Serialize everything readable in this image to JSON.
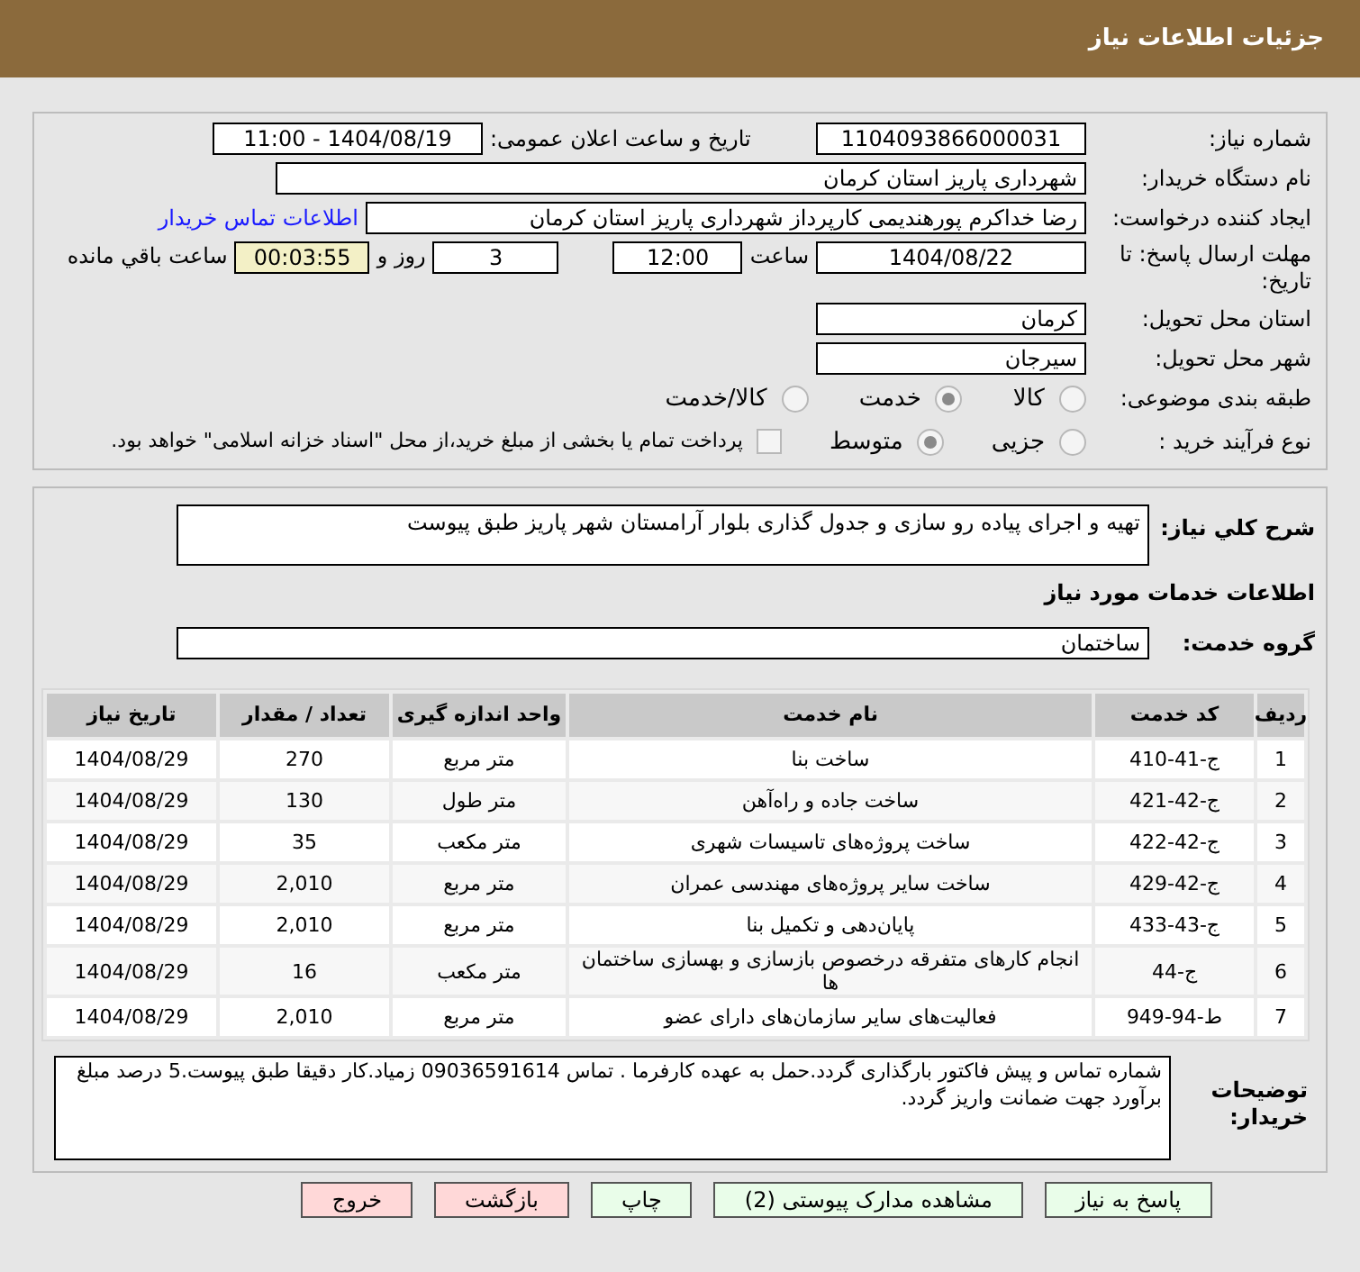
{
  "header": {
    "title": "جزئیات اطلاعات نیاز"
  },
  "need_number": {
    "label": "شماره نیاز:",
    "value": "1104093866000031"
  },
  "announce": {
    "label": "تاریخ و ساعت اعلان عمومی:",
    "value": "1404/08/19 - 11:00"
  },
  "buyer": {
    "label": "نام دستگاه خریدار:",
    "value": "شهرداری پاریز استان کرمان"
  },
  "creator": {
    "label": "ایجاد کننده درخواست:",
    "value": "رضا خداکرم پورهندیمی کارپرداز شهرداری پاریز استان کرمان",
    "link": "اطلاعات تماس خریدار"
  },
  "deadline": {
    "label": "مهلت ارسال پاسخ: تا تاریخ:",
    "date": "1404/08/22",
    "time_label": "ساعت",
    "time": "12:00",
    "days": "3",
    "days_label": "روز و",
    "remaining": "00:03:55",
    "remaining_label": "ساعت باقي مانده"
  },
  "province": {
    "label": "استان محل تحویل:",
    "value": "کرمان"
  },
  "city": {
    "label": "شهر محل تحویل:",
    "value": "سیرجان"
  },
  "category": {
    "label": "طبقه بندی موضوعی:",
    "options": [
      {
        "label": "کالا",
        "selected": false
      },
      {
        "label": "خدمت",
        "selected": true
      },
      {
        "label": "کالا/خدمت",
        "selected": false
      }
    ]
  },
  "purchase_type": {
    "label": "نوع فرآیند خرید :",
    "options": [
      {
        "label": "جزیی",
        "selected": false
      },
      {
        "label": "متوسط",
        "selected": true
      }
    ],
    "payment": {
      "checked": false,
      "text": "پرداخت تمام یا بخشی از مبلغ خرید،از محل \"اسناد خزانه اسلامی\" خواهد بود."
    }
  },
  "summary": {
    "label": "شرح کلي نیاز:",
    "value": "تهیه و اجرای پیاده رو سازی و جدول گذاری بلوار آرامستان شهر پاریز طبق پیوست"
  },
  "services_title": "اطلاعات خدمات مورد نیاز",
  "service_group": {
    "label": "گروه خدمت:",
    "value": "ساختمان"
  },
  "table": {
    "columns": [
      "ردیف",
      "کد خدمت",
      "نام خدمت",
      "واحد اندازه گیری",
      "تعداد / مقدار",
      "تاریخ نیاز"
    ],
    "rows": [
      [
        "1",
        "ج-41-410",
        "ساخت بنا",
        "متر مربع",
        "270",
        "1404/08/29"
      ],
      [
        "2",
        "ج-42-421",
        "ساخت جاده و راه‌آهن",
        "متر طول",
        "130",
        "1404/08/29"
      ],
      [
        "3",
        "ج-42-422",
        "ساخت پروژه‌های تاسیسات شهری",
        "متر مکعب",
        "35",
        "1404/08/29"
      ],
      [
        "4",
        "ج-42-429",
        "ساخت سایر پروژه‌های مهندسی عمران",
        "متر مربع",
        "2,010",
        "1404/08/29"
      ],
      [
        "5",
        "ج-43-433",
        "پایان‌دهی و تکمیل بنا",
        "متر مربع",
        "2,010",
        "1404/08/29"
      ],
      [
        "6",
        "ج-44",
        "انجام کارهای متفرقه درخصوص بازسازی و بهسازی ساختمان ها",
        "متر مکعب",
        "16",
        "1404/08/29"
      ],
      [
        "7",
        "ط-94-949",
        "فعالیت‌های سایر سازمان‌های دارای عضو",
        "متر مربع",
        "2,010",
        "1404/08/29"
      ]
    ]
  },
  "notes": {
    "label": "توضیحات خریدار:",
    "value": "شماره تماس و پیش فاکتور بارگذاری گردد.حمل به عهده کارفرما . تماس 09036591614 زمیاد.کار دقیقا طبق پیوست.5 درصد مبلغ برآورد جهت ضمانت واریز گردد."
  },
  "buttons": [
    {
      "label": "پاسخ به نیاز",
      "kind": "normal"
    },
    {
      "label": "مشاهده مدارک پیوستی (2)",
      "kind": "normal"
    },
    {
      "label": "چاپ",
      "kind": "normal"
    },
    {
      "label": "بازگشت",
      "kind": "danger"
    },
    {
      "label": "خروج",
      "kind": "danger"
    }
  ]
}
